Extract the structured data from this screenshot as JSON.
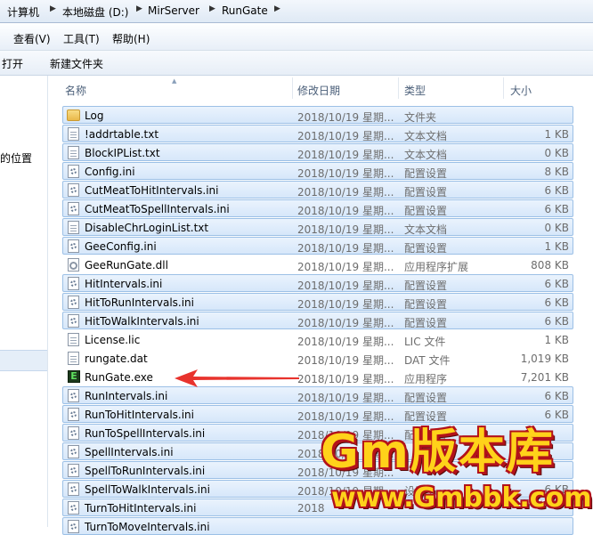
{
  "breadcrumb": {
    "items": [
      "计算机",
      "本地磁盘 (D:)",
      "MirServer",
      "RunGate"
    ]
  },
  "menu": {
    "items": [
      "查看(V)",
      "工具(T)",
      "帮助(H)"
    ]
  },
  "toolbar": {
    "open_label": "打开",
    "new_folder_label": "新建文件夹"
  },
  "navpane": {
    "partial_label": "的位置"
  },
  "columns": {
    "name": "名称",
    "date": "修改日期",
    "type": "类型",
    "size": "大小"
  },
  "files": [
    {
      "name": "Log",
      "date": "2018/10/19 星期...",
      "type": "文件夹",
      "size": "",
      "icon": "folder-icon",
      "selected": true
    },
    {
      "name": "!addrtable.txt",
      "date": "2018/10/19 星期...",
      "type": "文本文档",
      "size": "1 KB",
      "icon": "text-file-icon",
      "selected": true
    },
    {
      "name": "BlockIPList.txt",
      "date": "2018/10/19 星期...",
      "type": "文本文档",
      "size": "0 KB",
      "icon": "text-file-icon",
      "selected": true
    },
    {
      "name": "Config.ini",
      "date": "2018/10/19 星期...",
      "type": "配置设置",
      "size": "8 KB",
      "icon": "config-file-icon",
      "selected": true
    },
    {
      "name": "CutMeatToHitIntervals.ini",
      "date": "2018/10/19 星期...",
      "type": "配置设置",
      "size": "6 KB",
      "icon": "config-file-icon",
      "selected": true
    },
    {
      "name": "CutMeatToSpellIntervals.ini",
      "date": "2018/10/19 星期...",
      "type": "配置设置",
      "size": "6 KB",
      "icon": "config-file-icon",
      "selected": true
    },
    {
      "name": "DisableChrLoginList.txt",
      "date": "2018/10/19 星期...",
      "type": "文本文档",
      "size": "0 KB",
      "icon": "text-file-icon",
      "selected": true
    },
    {
      "name": "GeeConfig.ini",
      "date": "2018/10/19 星期...",
      "type": "配置设置",
      "size": "1 KB",
      "icon": "config-file-icon",
      "selected": true
    },
    {
      "name": "GeeRunGate.dll",
      "date": "2018/10/19 星期...",
      "type": "应用程序扩展",
      "size": "808 KB",
      "icon": "dll-file-icon",
      "selected": false
    },
    {
      "name": "HitIntervals.ini",
      "date": "2018/10/19 星期...",
      "type": "配置设置",
      "size": "6 KB",
      "icon": "config-file-icon",
      "selected": true
    },
    {
      "name": "HitToRunIntervals.ini",
      "date": "2018/10/19 星期...",
      "type": "配置设置",
      "size": "6 KB",
      "icon": "config-file-icon",
      "selected": true
    },
    {
      "name": "HitToWalkIntervals.ini",
      "date": "2018/10/19 星期...",
      "type": "配置设置",
      "size": "6 KB",
      "icon": "config-file-icon",
      "selected": true
    },
    {
      "name": "License.lic",
      "date": "2018/10/19 星期...",
      "type": "LIC 文件",
      "size": "1 KB",
      "icon": "text-file-icon",
      "selected": false
    },
    {
      "name": "rungate.dat",
      "date": "2018/10/19 星期...",
      "type": "DAT 文件",
      "size": "1,019 KB",
      "icon": "text-file-icon",
      "selected": false
    },
    {
      "name": "RunGate.exe",
      "date": "2018/10/19 星期...",
      "type": "应用程序",
      "size": "7,201 KB",
      "icon": "exe-file-icon",
      "selected": false
    },
    {
      "name": "RunIntervals.ini",
      "date": "2018/10/19 星期...",
      "type": "配置设置",
      "size": "6 KB",
      "icon": "config-file-icon",
      "selected": true
    },
    {
      "name": "RunToHitIntervals.ini",
      "date": "2018/10/19 星期...",
      "type": "配置设置",
      "size": "6 KB",
      "icon": "config-file-icon",
      "selected": true
    },
    {
      "name": "RunToSpellIntervals.ini",
      "date": "2018/10/19 星期...",
      "type": "配置设置",
      "size": "",
      "icon": "config-file-icon",
      "selected": true
    },
    {
      "name": "SpellIntervals.ini",
      "date": "2018/10/19 星期...",
      "type": "",
      "size": "",
      "icon": "config-file-icon",
      "selected": true
    },
    {
      "name": "SpellToRunIntervals.ini",
      "date": "2018/10/19 星期...",
      "type": "",
      "size": "",
      "icon": "config-file-icon",
      "selected": true
    },
    {
      "name": "SpellToWalkIntervals.ini",
      "date": "2018/10/19 星期...",
      "type": "设置",
      "size": "6 KB",
      "icon": "config-file-icon",
      "selected": true
    },
    {
      "name": "TurnToHitIntervals.ini",
      "date": "2018",
      "type": "",
      "size": "",
      "icon": "config-file-icon",
      "selected": true
    },
    {
      "name": "TurnToMoveIntervals.ini",
      "date": "",
      "type": "",
      "size": "",
      "icon": "config-file-icon",
      "selected": true
    }
  ],
  "watermark": {
    "line1": "Gm版本库",
    "line2": "www.Gmbbk.com"
  },
  "colors": {
    "selection_bg": "#d6e7fa",
    "selection_border": "#9cc0e6",
    "arrow": "#e8332d",
    "watermark_fill": "#ffd21a",
    "watermark_outline": "#b3121a"
  }
}
